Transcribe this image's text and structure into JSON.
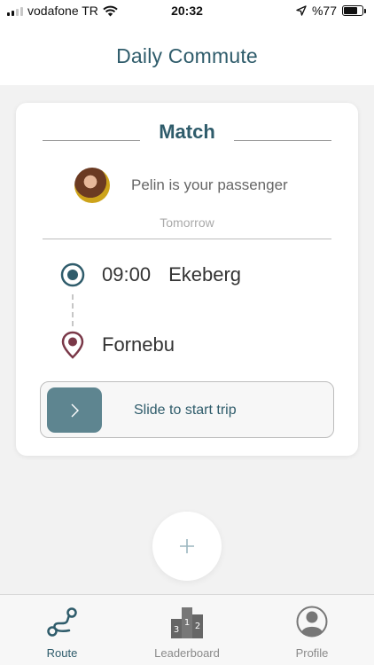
{
  "status_bar": {
    "carrier": "vodafone TR",
    "time": "20:32",
    "battery": "%77"
  },
  "header": {
    "title": "Daily Commute"
  },
  "match": {
    "title": "Match",
    "passenger_text": "Pelin is your passenger",
    "when": "Tomorrow",
    "origin_time": "09:00",
    "origin_name": "Ekeberg",
    "destination_name": "Fornebu",
    "slide_label": "Slide to start trip"
  },
  "fab": {
    "icon": "plus-icon"
  },
  "tabs": [
    {
      "label": "Route",
      "icon": "route-icon",
      "active": true
    },
    {
      "label": "Leaderboard",
      "icon": "podium-icon",
      "active": false
    },
    {
      "label": "Profile",
      "icon": "profile-icon",
      "active": false
    }
  ],
  "colors": {
    "brand": "#2f5c6b",
    "slider_handle": "#5e8590",
    "destination_pin": "#7a3848"
  }
}
